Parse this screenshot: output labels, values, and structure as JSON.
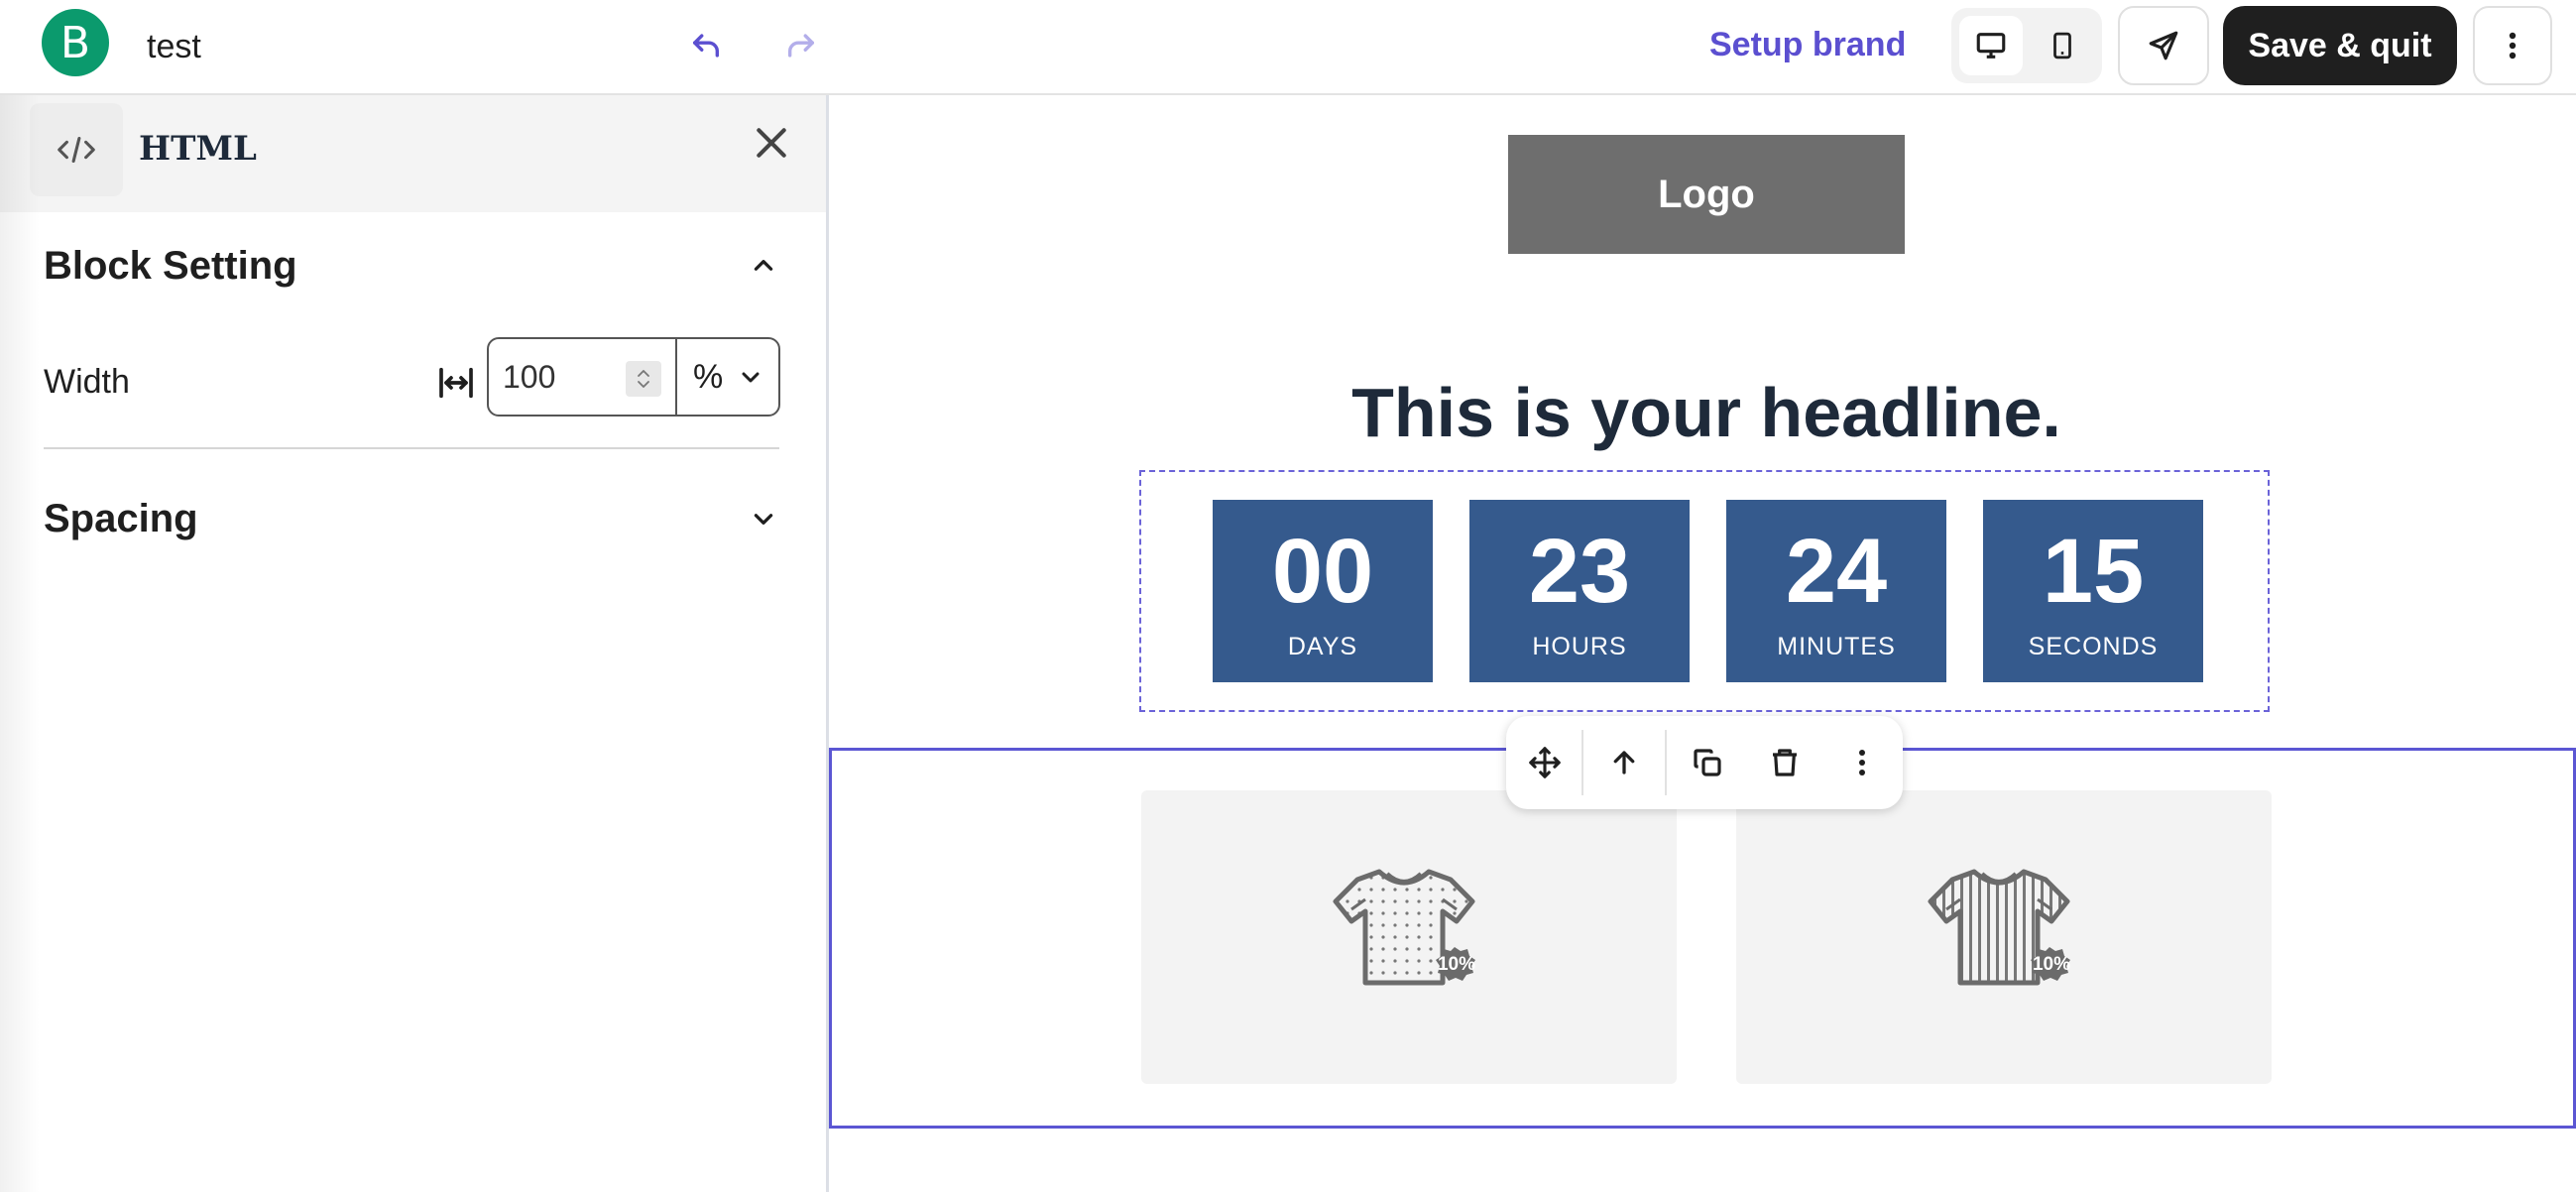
{
  "topbar": {
    "brand_initial": "B",
    "document_name": "test",
    "setup_brand_label": "Setup brand",
    "save_quit_label": "Save & quit"
  },
  "panel": {
    "title": "HTML",
    "block_setting_title": "Block Setting",
    "width_label": "Width",
    "width_value": "100",
    "width_unit": "%",
    "spacing_title": "Spacing"
  },
  "canvas": {
    "logo_text": "Logo",
    "headline": "This is your headline.",
    "countdown": [
      {
        "value": "00",
        "unit": "DAYS"
      },
      {
        "value": "23",
        "unit": "HOURS"
      },
      {
        "value": "24",
        "unit": "MINUTES"
      },
      {
        "value": "15",
        "unit": "SECONDS"
      }
    ],
    "products": [
      {
        "badge": "10%",
        "pattern": "dots"
      },
      {
        "badge": "10%",
        "pattern": "stripes"
      }
    ]
  },
  "colors": {
    "accent": "#5b4fd0",
    "brand_green": "#0b9a6d",
    "countdown_bg": "#355a8d",
    "selection_border": "#5b56d3"
  },
  "icons": {
    "undo": "undo-icon",
    "redo": "redo-icon",
    "desktop": "desktop-icon",
    "mobile": "mobile-icon",
    "send": "send-icon",
    "more": "more-vertical-icon",
    "close": "close-icon",
    "code": "code-icon",
    "move": "move-icon",
    "arrow_up": "arrow-up-icon",
    "duplicate": "duplicate-icon",
    "trash": "trash-icon"
  }
}
